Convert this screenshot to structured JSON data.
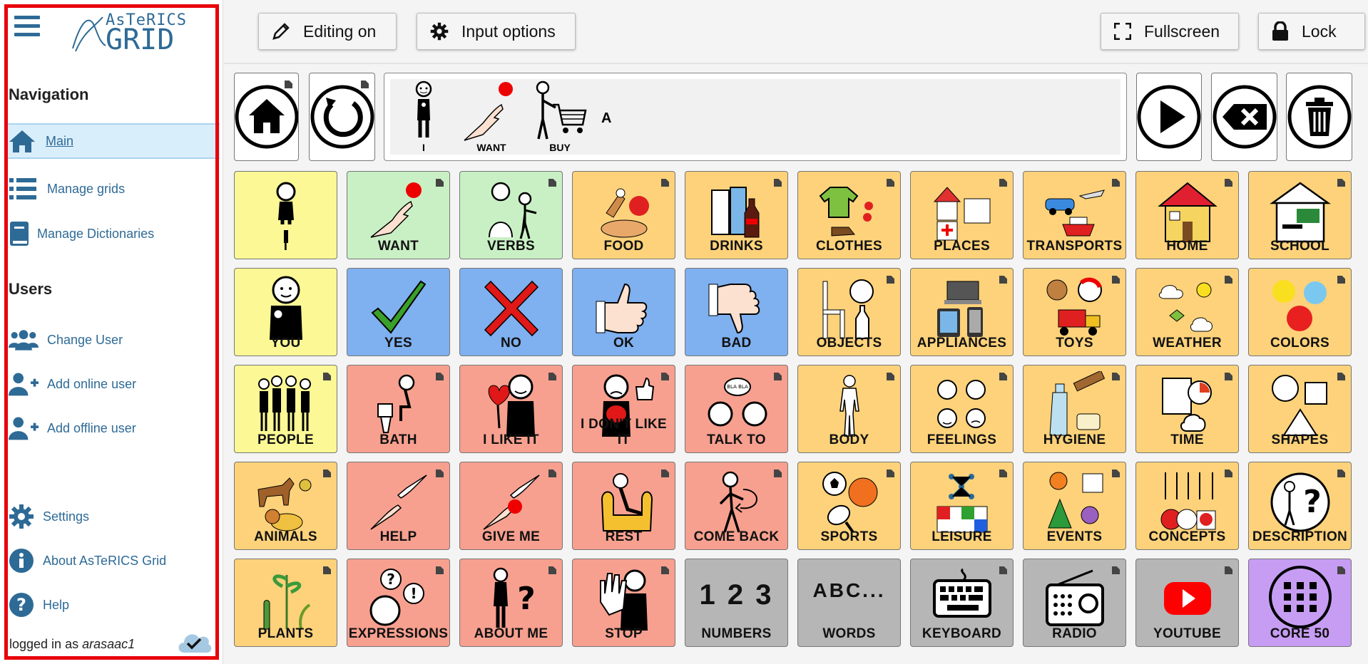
{
  "app": {
    "logo_top": "AsTeRICS",
    "logo_bottom": "GRID"
  },
  "sidebar": {
    "navigation_title": "Navigation",
    "nav_items": [
      {
        "label": "Main",
        "icon": "home-icon",
        "active": true
      },
      {
        "label": "Manage grids",
        "icon": "list-icon"
      },
      {
        "label": "Manage Dictionaries",
        "icon": "book-icon"
      }
    ],
    "users_title": "Users",
    "user_items": [
      {
        "label": "Change User",
        "icon": "users-icon"
      },
      {
        "label": "Add online user",
        "icon": "user-plus-icon"
      },
      {
        "label": "Add offline user",
        "icon": "user-plus-icon"
      }
    ],
    "bottom_items": [
      {
        "label": "Settings",
        "icon": "gear-icon"
      },
      {
        "label": "About AsTeRICS Grid",
        "icon": "info-icon"
      },
      {
        "label": "Help",
        "icon": "question-icon"
      }
    ],
    "logged_in_prefix": "logged in as",
    "username": "arasaac1",
    "accent_color": "#e8000b"
  },
  "toolbar": {
    "editing_label": "Editing on",
    "input_options_label": "Input options",
    "fullscreen_label": "Fullscreen",
    "lock_label": "Lock"
  },
  "sentence": {
    "words": [
      "I",
      "WANT",
      "BUY"
    ],
    "letter": "A"
  },
  "grid": {
    "rows": [
      [
        {
          "label": "I",
          "color": "yellow"
        },
        {
          "label": "WANT",
          "color": "green"
        },
        {
          "label": "VERBS",
          "color": "green"
        },
        {
          "label": "FOOD",
          "color": "orange"
        },
        {
          "label": "DRINKS",
          "color": "orange"
        },
        {
          "label": "CLOTHES",
          "color": "orange"
        },
        {
          "label": "PLACES",
          "color": "orange"
        },
        {
          "label": "TRANSPORTS",
          "color": "orange"
        },
        {
          "label": "HOME",
          "color": "orange"
        },
        {
          "label": "SCHOOL",
          "color": "orange"
        }
      ],
      [
        {
          "label": "YOU",
          "color": "yellow"
        },
        {
          "label": "YES",
          "color": "blue"
        },
        {
          "label": "NO",
          "color": "blue"
        },
        {
          "label": "OK",
          "color": "blue"
        },
        {
          "label": "BAD",
          "color": "blue"
        },
        {
          "label": "OBJECTS",
          "color": "orange"
        },
        {
          "label": "APPLIANCES",
          "color": "orange"
        },
        {
          "label": "TOYS",
          "color": "orange"
        },
        {
          "label": "WEATHER",
          "color": "orange"
        },
        {
          "label": "COLORS",
          "color": "orange"
        }
      ],
      [
        {
          "label": "PEOPLE",
          "color": "yellow"
        },
        {
          "label": "BATH",
          "color": "red"
        },
        {
          "label": "I LIKE IT",
          "color": "red"
        },
        {
          "label": "I DON'T LIKE IT",
          "color": "red"
        },
        {
          "label": "TALK TO",
          "color": "red"
        },
        {
          "label": "BODY",
          "color": "orange"
        },
        {
          "label": "FEELINGS",
          "color": "orange"
        },
        {
          "label": "HYGIENE",
          "color": "orange"
        },
        {
          "label": "TIME",
          "color": "orange"
        },
        {
          "label": "SHAPES",
          "color": "orange"
        }
      ],
      [
        {
          "label": "ANIMALS",
          "color": "orange"
        },
        {
          "label": "HELP",
          "color": "red"
        },
        {
          "label": "GIVE ME",
          "color": "red"
        },
        {
          "label": "REST",
          "color": "red"
        },
        {
          "label": "COME BACK",
          "color": "red"
        },
        {
          "label": "SPORTS",
          "color": "orange"
        },
        {
          "label": "LEISURE",
          "color": "orange"
        },
        {
          "label": "EVENTS",
          "color": "orange"
        },
        {
          "label": "CONCEPTS",
          "color": "orange"
        },
        {
          "label": "DESCRIPTION",
          "color": "orange"
        }
      ],
      [
        {
          "label": "PLANTS",
          "color": "orange"
        },
        {
          "label": "EXPRESSIONS",
          "color": "red"
        },
        {
          "label": "ABOUT ME",
          "color": "red"
        },
        {
          "label": "STOP",
          "color": "red"
        },
        {
          "label": "NUMBERS",
          "color": "gray",
          "pic_text": "1 2 3"
        },
        {
          "label": "WORDS",
          "color": "gray",
          "pic_text": "ABC..."
        },
        {
          "label": "KEYBOARD",
          "color": "gray"
        },
        {
          "label": "RADIO",
          "color": "gray"
        },
        {
          "label": "YOUTUBE",
          "color": "gray"
        },
        {
          "label": "CORE 50",
          "color": "purple"
        }
      ]
    ]
  }
}
